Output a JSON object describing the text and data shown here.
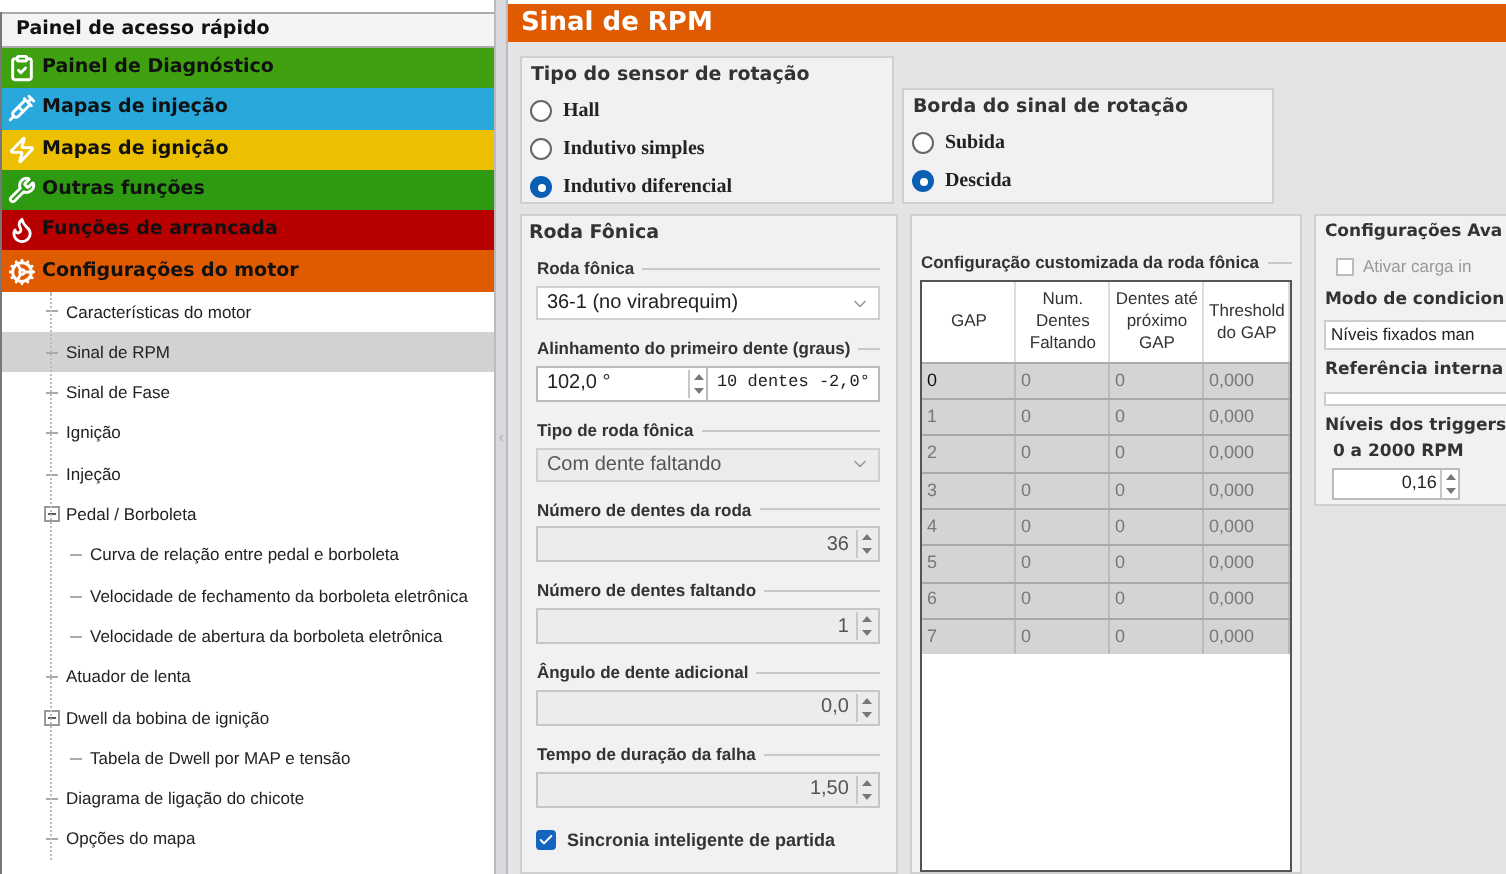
{
  "sidebar": {
    "title": "Painel de acesso rápido",
    "menu": [
      {
        "label": "Painel de Diagnóstico",
        "kind": "diagnostic",
        "color": "#3fa010"
      },
      {
        "label": "Mapas de injeção",
        "kind": "injection",
        "color": "#29a8dc"
      },
      {
        "label": "Mapas de ignição",
        "kind": "ignition",
        "color": "#ecc000"
      },
      {
        "label": "Outras funções",
        "kind": "other",
        "color": "#2d9a12"
      },
      {
        "label": "Funções de arrancada",
        "kind": "cranking",
        "color": "#b80000"
      },
      {
        "label": "Configurações do motor",
        "kind": "engine",
        "color": "#e05a00"
      }
    ],
    "tree": [
      {
        "label": "Características do motor",
        "selected": false
      },
      {
        "label": "Sinal de RPM",
        "selected": true
      },
      {
        "label": "Sinal de Fase",
        "selected": false
      },
      {
        "label": "Ignição",
        "selected": false
      },
      {
        "label": "Injeção",
        "selected": false
      },
      {
        "label": "Pedal / Borboleta",
        "selected": false,
        "expanded": true,
        "children": [
          {
            "label": "Curva de relação entre pedal e borboleta",
            "selected": false
          },
          {
            "label": "Velocidade de fechamento da borboleta eletrônica",
            "selected": false
          },
          {
            "label": "Velocidade de abertura da borboleta eletrônica",
            "selected": false
          }
        ]
      },
      {
        "label": "Atuador de lenta",
        "selected": false
      },
      {
        "label": "Dwell da bobina de ignição",
        "selected": false,
        "expanded": true,
        "children": [
          {
            "label": "Tabela de Dwell por MAP e tensão",
            "selected": false
          }
        ]
      },
      {
        "label": "Diagrama de ligação do chicote",
        "selected": false
      },
      {
        "label": "Opções do mapa",
        "selected": false
      }
    ]
  },
  "panel": {
    "title": "Sinal de RPM",
    "sensor_type": {
      "title": "Tipo do sensor de rotação",
      "options": [
        {
          "label": "Hall",
          "selected": false
        },
        {
          "label": "Indutivo simples",
          "selected": false
        },
        {
          "label": "Indutivo diferencial",
          "selected": true
        }
      ]
    },
    "signal_edge": {
      "title": "Borda do sinal de rotação",
      "options": [
        {
          "label": "Subida",
          "selected": false
        },
        {
          "label": "Descida",
          "selected": true
        }
      ]
    },
    "trigger_wheel": {
      "title": "Roda Fônica",
      "fields": [
        {
          "kind": "select",
          "label": "Roda fônica",
          "value": "36-1 (no virabrequim)",
          "disabled": false
        },
        {
          "kind": "spin_pair",
          "label": "Alinhamento do primeiro dente (graus)",
          "value": "102,0 °",
          "extra": "10 dentes -2,0°",
          "disabled": false
        },
        {
          "kind": "select",
          "label": "Tipo de roda fônica",
          "value": "Com dente faltando",
          "disabled": true
        },
        {
          "kind": "spin",
          "label": "Número de dentes da roda",
          "value": "36",
          "disabled": true
        },
        {
          "kind": "spin",
          "label": "Número de dentes faltando",
          "value": "1",
          "disabled": true
        },
        {
          "kind": "spin",
          "label": "Ângulo de dente adicional",
          "value": "0,0",
          "disabled": true
        },
        {
          "kind": "spin",
          "label": "Tempo de duração da falha",
          "value": "1,50",
          "disabled": true
        }
      ],
      "smart_sync": {
        "label": "Sincronia inteligente de partida",
        "checked": true
      }
    },
    "custom_wheel": {
      "title": "Configuração customizada da roda fônica",
      "columns": [
        "GAP",
        "Num. Dentes Faltando",
        "Dentes até próximo GAP",
        "Threshold do GAP"
      ],
      "rows": [
        [
          "0",
          "0",
          "0",
          "0,000"
        ],
        [
          "1",
          "0",
          "0",
          "0,000"
        ],
        [
          "2",
          "0",
          "0",
          "0,000"
        ],
        [
          "3",
          "0",
          "0",
          "0,000"
        ],
        [
          "4",
          "0",
          "0",
          "0,000"
        ],
        [
          "5",
          "0",
          "0",
          "0,000"
        ],
        [
          "6",
          "0",
          "0",
          "0,000"
        ],
        [
          "7",
          "0",
          "0",
          "0,000"
        ]
      ]
    },
    "advanced": {
      "title": "Configurações Ava",
      "load_checkbox": {
        "label": "Ativar carga in",
        "checked": false
      },
      "mode_label": "Modo de condicion",
      "mode_value": "Níveis fixados man",
      "reference_label": "Referência interna",
      "trigger_label": "Níveis dos triggers",
      "range_label": "0 a 2000 RPM",
      "range_value": "0,16"
    }
  }
}
